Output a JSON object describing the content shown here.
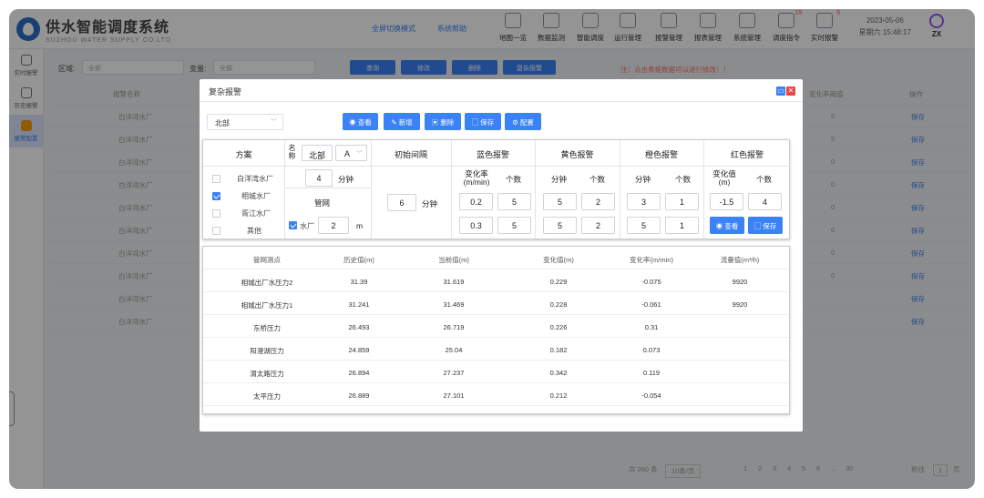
{
  "app": {
    "title": "供水智能调度系统",
    "subtitle": "SUZHOU WATER SUPPLY CO.LTD",
    "top_links": [
      "全屏切换模式",
      "系统帮助"
    ],
    "nav": [
      {
        "label": "地图一览",
        "icon": "map-icon"
      },
      {
        "label": "数据监测",
        "icon": "monitor-icon"
      },
      {
        "label": "智能调度",
        "icon": "dispatch-icon"
      },
      {
        "label": "运行管理",
        "icon": "operation-icon"
      },
      {
        "label": "报警管理",
        "icon": "alarm-icon"
      },
      {
        "label": "报表管理",
        "icon": "report-icon"
      },
      {
        "label": "系统管理",
        "icon": "settings-icon"
      },
      {
        "label": "调度指令",
        "icon": "command-icon",
        "badge": "19"
      },
      {
        "label": "实时报警",
        "icon": "bell-icon",
        "badge": "5"
      }
    ],
    "date": "2023-05-06",
    "time": "星期六 15:48:17",
    "user": "ZX"
  },
  "sidebar": [
    {
      "label": "实时报警",
      "active": false
    },
    {
      "label": "历史报警",
      "active": false
    },
    {
      "label": "报警配置",
      "active": true
    }
  ],
  "filter": {
    "region_label": "区域:",
    "region_value": "全部",
    "var_label": "变量:",
    "var_value": "全部",
    "buttons": [
      "查询",
      "修改",
      "删除",
      "复杂报警"
    ],
    "hint": "注：点击表格数据可以进行修改！！"
  },
  "bg_table": {
    "col_first": "报警名称",
    "col_rate": "变化率阈值",
    "col_op": "操作",
    "rows": [
      "白洋湾水厂",
      "白洋湾水厂",
      "白洋湾水厂",
      "白洋湾水厂",
      "白洋湾水厂",
      "白洋湾水厂",
      "白洋湾水厂",
      "白洋湾水厂",
      "白洋湾水厂",
      "白洋湾水厂"
    ],
    "rates": [
      "5",
      "5",
      "0",
      "0",
      "0",
      "0",
      "0",
      "0",
      "",
      ""
    ],
    "op": "保存"
  },
  "pager": {
    "total": "共 260 条",
    "size": "10条/页",
    "pages": [
      "1",
      "2",
      "3",
      "4",
      "5",
      "6",
      "...",
      "30"
    ],
    "goto": "前往",
    "page_input": "1",
    "suffix": "页"
  },
  "dialog": {
    "title": "复杂报警",
    "region": "北部",
    "actions": [
      "查看",
      "新增",
      "删除",
      "保存",
      "配置"
    ],
    "headers": {
      "scheme": "方案",
      "name": "名称",
      "region": "北部",
      "group": "A",
      "init": "初始间隔",
      "blue": "蓝色报警",
      "yellow": "黄色报警",
      "orange": "橙色报警",
      "red": "红色报警"
    },
    "sub": {
      "rate": "变化率(m/min)",
      "count": "个数",
      "minute": "分钟",
      "value": "变化值(m)"
    },
    "schemes": [
      {
        "label": "白洋湾水厂",
        "checked": false
      },
      {
        "label": "相城水厂",
        "checked": true
      },
      {
        "label": "胥江水厂",
        "checked": false
      },
      {
        "label": "其他",
        "checked": false
      }
    ],
    "interval_value": "4",
    "interval_unit": "分钟",
    "pipe_label": "管网",
    "factory_label": "水厂",
    "factory_value": "2",
    "factory_unit": "m",
    "init_value": "6",
    "init_unit": "分钟",
    "blue": [
      [
        "0.2",
        "5"
      ],
      [
        "0.3",
        "5"
      ]
    ],
    "yellow": [
      [
        "5",
        "2"
      ],
      [
        "5",
        "2"
      ]
    ],
    "orange": [
      [
        "3",
        "1"
      ],
      [
        "5",
        "1"
      ]
    ],
    "red": [
      [
        "-1.5",
        "4"
      ]
    ],
    "red_buttons": [
      "查看",
      "保存"
    ]
  },
  "data_table": {
    "headers": [
      "管网测点",
      "历史值(m)",
      "当前值(m)",
      "变化值(m)",
      "变化率(m/min)",
      "流量值(m³/h)"
    ],
    "rows": [
      [
        "相城出厂水压力2",
        "31.39",
        "31.619",
        "0.229",
        "-0.075",
        "9920"
      ],
      [
        "相城出厂水压力1",
        "31.241",
        "31.469",
        "0.228",
        "-0.061",
        "9920"
      ],
      [
        "东桥压力",
        "26.493",
        "26.719",
        "0.226",
        "0.31",
        ""
      ],
      [
        "阳澄湖压力",
        "24.859",
        "25.04",
        "0.182",
        "0.073",
        ""
      ],
      [
        "渭太路压力",
        "26.894",
        "27.237",
        "0.342",
        "0.119",
        ""
      ],
      [
        "太平压力",
        "26.889",
        "27.101",
        "0.212",
        "-0.054",
        ""
      ]
    ]
  },
  "colors": {
    "primary": "#3b82f6",
    "danger": "#ff4d4f",
    "overlay": "rgba(0,0,0,0.42)"
  }
}
